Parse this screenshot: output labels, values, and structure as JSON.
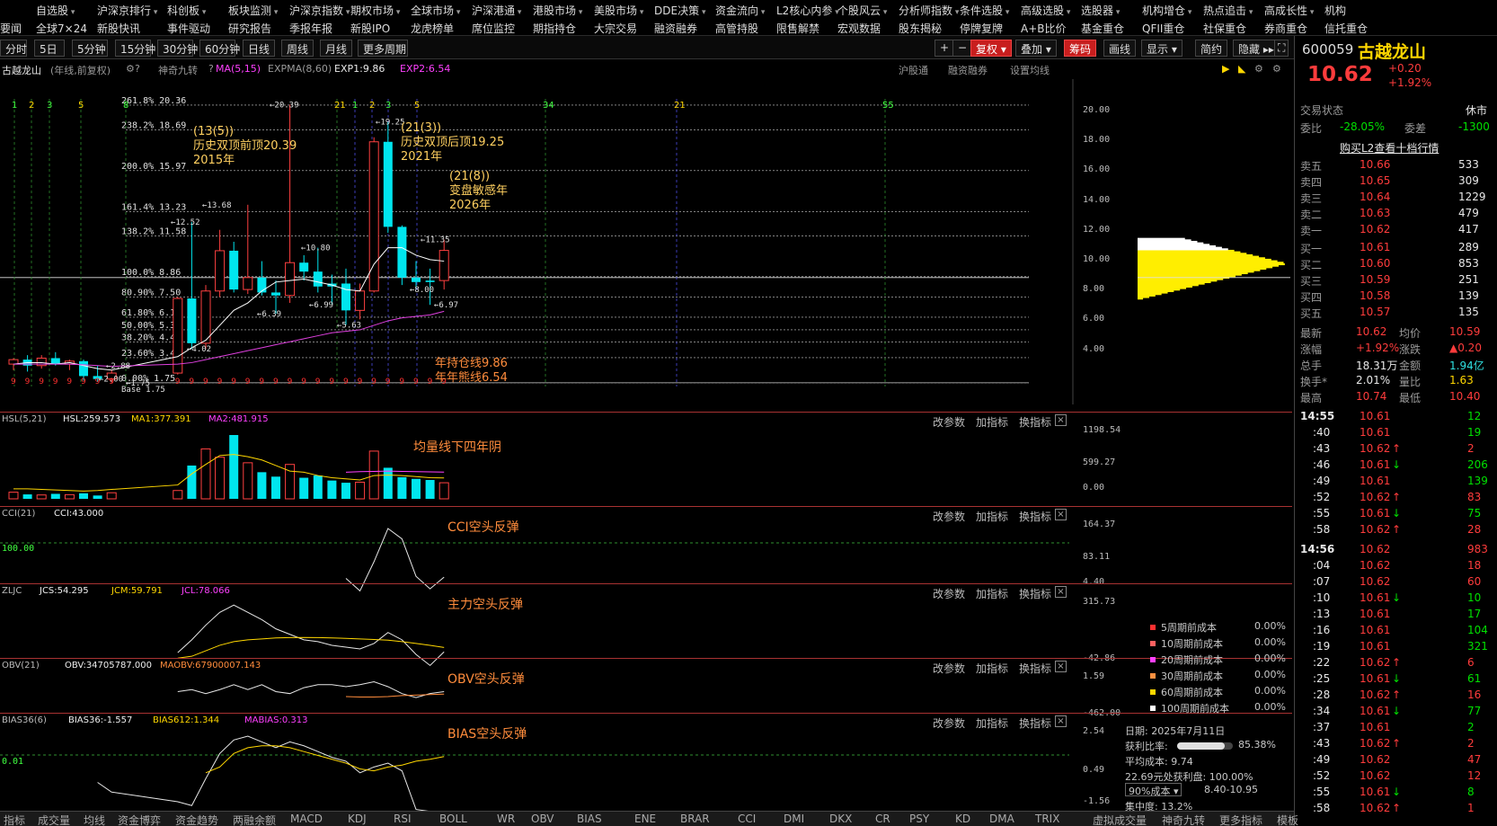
{
  "menu": {
    "row1": [
      "自选股",
      "沪深京排行",
      "科创板",
      "板块监测",
      "沪深京指数",
      "期权市场",
      "全球市场",
      "沪深港通",
      "港股市场",
      "美股市场",
      "DDE决策",
      "资金流向",
      "L2核心内参",
      "个股风云",
      "分析师指数",
      "条件选股",
      "高级选股",
      "选股器",
      "机构增仓",
      "热点追击",
      "高成长性",
      "机构"
    ],
    "row2": [
      "要闻",
      "全球7×24",
      "新股快讯",
      "事件驱动",
      "研究报告",
      "季报年报",
      "新股IPO",
      "龙虎榜单",
      "席位监控",
      "期指持仓",
      "大宗交易",
      "融资融券",
      "高管持股",
      "限售解禁",
      "宏观数据",
      "股东揭秘",
      "停牌复牌",
      "A+B比价",
      "基金重仓",
      "QFII重仓",
      "社保重仓",
      "券商重仓",
      "信托重仓"
    ]
  },
  "toolbar": {
    "periods": [
      "分时",
      "5日",
      "5分钟",
      "15分钟",
      "30分钟",
      "60分钟",
      "日线",
      "周线",
      "月线",
      "更多周期"
    ],
    "plus": "+",
    "minus": "−",
    "fuquan": "复权",
    "diejia": "叠加",
    "chouma": "筹码",
    "huaxian": "画线",
    "xianshi": "显示",
    "jianyue": "简约",
    "yincang": "隐藏"
  },
  "chart": {
    "stock_name": "古越龙山",
    "mode": "(年线,前复权)",
    "indicator": "神奇九转",
    "ma_label": "MA(5,15)",
    "expma_label": "EXPMA(8,60)",
    "exp1": "EXP1:9.86",
    "exp2": "EXP2:6.54",
    "links": [
      "沪股通",
      "融资融券",
      "设置均线"
    ],
    "fib_levels": [
      {
        "label": "261.8% 20.36",
        "value": 20.36
      },
      {
        "label": "238.2% 18.69",
        "value": 18.69
      },
      {
        "label": "200.0% 15.97",
        "value": 15.97
      },
      {
        "label": "161.4% 13.23",
        "value": 13.23
      },
      {
        "label": "138.2% 11.58",
        "value": 11.58
      },
      {
        "label": "100.0% 8.86",
        "value": 8.86
      },
      {
        "label": "80.90% 7.50",
        "value": 7.5
      },
      {
        "label": "61.80% 6.14",
        "value": 6.14
      },
      {
        "label": "50.00% 5.30",
        "value": 5.3
      },
      {
        "label": "38.20% 4.47",
        "value": 4.47
      },
      {
        "label": "23.60% 3.43",
        "value": 3.43
      },
      {
        "label": "0.00% 1.75",
        "value": 1.75
      },
      {
        "label": "Base 1.75",
        "value": 1.75
      }
    ],
    "y_ticks": [
      "20.00",
      "18.00",
      "16.00",
      "14.00",
      "12.00",
      "10.00",
      "8.00",
      "6.00",
      "4.00"
    ],
    "cycle_marks": [
      "1",
      "2",
      "3",
      "5",
      "8",
      "21",
      "1",
      "2",
      "3",
      "5",
      "34",
      "21",
      "55"
    ],
    "annotations": [
      {
        "line1": "(13(5))",
        "line2": "历史双顶前顶20.39",
        "line3": "2015年"
      },
      {
        "line1": "(21(3))",
        "line2": "历史双顶后顶19.25",
        "line3": "2021年"
      },
      {
        "line1": "(21(8))",
        "line2": "变盘敏感年",
        "line3": "2026年"
      }
    ],
    "price_labels": [
      "20.39",
      "19.25",
      "13.68",
      "12.52",
      "10.80",
      "11.35",
      "8.00",
      "6.97",
      "6.99",
      "6.39",
      "5.63",
      "4.02",
      "2.88",
      "2.00",
      "1.75"
    ],
    "year_lines": "年持仓线9.86",
    "year_lines2": "年年熊线6.54",
    "nine_marks": "9"
  },
  "panels": {
    "hsl": {
      "title": "HSL(5,21)",
      "v": "HSL:259.573",
      "ma1": "MA1:377.391",
      "ma2": "MA2:481.915",
      "note": "均量线下四年阴",
      "y": [
        "1198.54",
        "599.27",
        "0.00"
      ]
    },
    "cci": {
      "title": "CCI(21)",
      "v": "CCI:43.000",
      "note": "CCI空头反弹",
      "y": [
        "164.37",
        "83.11",
        "4.40"
      ],
      "left": "100.00"
    },
    "zljc": {
      "title": "ZLJC",
      "jcs": "JCS:54.295",
      "jcm": "JCM:59.791",
      "jcl": "JCL:78.066",
      "note": "主力空头反弹",
      "y": [
        "315.73",
        "-42.86"
      ]
    },
    "obv": {
      "title": "OBV(21)",
      "v": "OBV:34705787.000",
      "maobv": "MAOBV:67900007.143",
      "note": "OBV空头反弹",
      "y": [
        "1.59",
        "-462.00"
      ]
    },
    "bias": {
      "title": "BIAS36(6)",
      "v": "BIAS36:-1.557",
      "b612": "BIAS612:1.344",
      "mabias": "MABIAS:0.313",
      "note": "BIAS空头反弹",
      "y": [
        "2.54",
        "0.49",
        "-1.56"
      ],
      "left": "0.01"
    },
    "buttons": [
      "改参数",
      "加指标",
      "换指标"
    ]
  },
  "chip": {
    "legend": [
      {
        "label": "5周期前成本",
        "value": "0.00%",
        "color": "#ff3030"
      },
      {
        "label": "10周期前成本",
        "value": "0.00%",
        "color": "#ff6060"
      },
      {
        "label": "20周期前成本",
        "value": "0.00%",
        "color": "#ff40ff"
      },
      {
        "label": "30周期前成本",
        "value": "0.00%",
        "color": "#ff9040"
      },
      {
        "label": "60周期前成本",
        "value": "0.00%",
        "color": "#ffd700"
      },
      {
        "label": "100周期前成本",
        "value": "0.00%",
        "color": "#ffffff"
      }
    ],
    "date": "日期: 2025年7月11日",
    "profit_label": "获利比率:",
    "profit": "85.38%",
    "profit_fraction": 0.8538,
    "avg_cost": "平均成本: 9.74",
    "profit_line": "22.69元处获利盘: 100.00%",
    "cost_select": "90%成本",
    "cost_range": "8.40-10.95",
    "concentration": "集中度: 13.2%"
  },
  "quote": {
    "code": "600059",
    "name": "古越龙山",
    "price": "10.62",
    "change": "+0.20",
    "change_pct": "+1.92%",
    "status_label": "交易状态",
    "status": "休市",
    "weibi_label": "委比",
    "weibi": "-28.05%",
    "weicha_label": "委差",
    "weicha": "-1300",
    "l2_link": "购买L2查看十档行情",
    "sells": [
      {
        "label": "卖五",
        "price": "10.66",
        "vol": "533"
      },
      {
        "label": "卖四",
        "price": "10.65",
        "vol": "309"
      },
      {
        "label": "卖三",
        "price": "10.64",
        "vol": "1229"
      },
      {
        "label": "卖二",
        "price": "10.63",
        "vol": "479"
      },
      {
        "label": "卖一",
        "price": "10.62",
        "vol": "417"
      }
    ],
    "buys": [
      {
        "label": "买一",
        "price": "10.61",
        "vol": "289"
      },
      {
        "label": "买二",
        "price": "10.60",
        "vol": "853"
      },
      {
        "label": "买三",
        "price": "10.59",
        "vol": "251"
      },
      {
        "label": "买四",
        "price": "10.58",
        "vol": "139"
      },
      {
        "label": "买五",
        "price": "10.57",
        "vol": "135"
      }
    ],
    "stats": [
      {
        "l1": "最新",
        "v1": "10.62",
        "c1": "red",
        "l2": "均价",
        "v2": "10.59",
        "c2": "red"
      },
      {
        "l1": "涨幅",
        "v1": "+1.92%",
        "c1": "red",
        "l2": "涨跌",
        "v2": "▲0.20",
        "c2": "red"
      },
      {
        "l1": "总手",
        "v1": "18.31万",
        "c1": "white",
        "l2": "金额",
        "v2": "1.94亿",
        "c2": "cyan"
      },
      {
        "l1": "换手*",
        "v1": "2.01%",
        "c1": "white",
        "l2": "量比",
        "v2": "1.63",
        "c2": "yellow"
      },
      {
        "l1": "最高",
        "v1": "10.74",
        "c1": "red",
        "l2": "最低",
        "v2": "10.40",
        "c2": "red"
      }
    ],
    "ticks1": {
      "time": "14:55",
      "rows": [
        {
          "t": "14:55",
          "p": "10.61",
          "pc": "red",
          "a": "",
          "v": "12",
          "vc": "green"
        },
        {
          "t": ":40",
          "p": "10.61",
          "pc": "red",
          "a": "",
          "v": "19",
          "vc": "green"
        },
        {
          "t": ":43",
          "p": "10.62",
          "pc": "red",
          "a": "↑",
          "v": "2",
          "vc": "red"
        },
        {
          "t": ":46",
          "p": "10.61",
          "pc": "red",
          "a": "↓",
          "v": "206",
          "vc": "green"
        },
        {
          "t": ":49",
          "p": "10.61",
          "pc": "red",
          "a": "",
          "v": "139",
          "vc": "green"
        },
        {
          "t": ":52",
          "p": "10.62",
          "pc": "red",
          "a": "↑",
          "v": "83",
          "vc": "red"
        },
        {
          "t": ":55",
          "p": "10.61",
          "pc": "red",
          "a": "↓",
          "v": "75",
          "vc": "green"
        },
        {
          "t": ":58",
          "p": "10.62",
          "pc": "red",
          "a": "↑",
          "v": "28",
          "vc": "red"
        }
      ]
    },
    "ticks2": {
      "rows": [
        {
          "t": "14:56",
          "p": "10.62",
          "pc": "red",
          "a": "",
          "v": "983",
          "vc": "red"
        },
        {
          "t": ":04",
          "p": "10.62",
          "pc": "red",
          "a": "",
          "v": "18",
          "vc": "red"
        },
        {
          "t": ":07",
          "p": "10.62",
          "pc": "red",
          "a": "",
          "v": "60",
          "vc": "red"
        },
        {
          "t": ":10",
          "p": "10.61",
          "pc": "red",
          "a": "↓",
          "v": "10",
          "vc": "green"
        },
        {
          "t": ":13",
          "p": "10.61",
          "pc": "red",
          "a": "",
          "v": "17",
          "vc": "green"
        },
        {
          "t": ":16",
          "p": "10.61",
          "pc": "red",
          "a": "",
          "v": "104",
          "vc": "green"
        },
        {
          "t": ":19",
          "p": "10.61",
          "pc": "red",
          "a": "",
          "v": "321",
          "vc": "green"
        },
        {
          "t": ":22",
          "p": "10.62",
          "pc": "red",
          "a": "↑",
          "v": "6",
          "vc": "red"
        },
        {
          "t": ":25",
          "p": "10.61",
          "pc": "red",
          "a": "↓",
          "v": "61",
          "vc": "green"
        },
        {
          "t": ":28",
          "p": "10.62",
          "pc": "red",
          "a": "↑",
          "v": "16",
          "vc": "red"
        },
        {
          "t": ":34",
          "p": "10.61",
          "pc": "red",
          "a": "↓",
          "v": "77",
          "vc": "green"
        },
        {
          "t": ":37",
          "p": "10.61",
          "pc": "red",
          "a": "",
          "v": "2",
          "vc": "green"
        },
        {
          "t": ":43",
          "p": "10.62",
          "pc": "red",
          "a": "↑",
          "v": "2",
          "vc": "red"
        },
        {
          "t": ":49",
          "p": "10.62",
          "pc": "red",
          "a": "",
          "v": "47",
          "vc": "red"
        },
        {
          "t": ":52",
          "p": "10.62",
          "pc": "red",
          "a": "",
          "v": "12",
          "vc": "red"
        },
        {
          "t": ":55",
          "p": "10.61",
          "pc": "red",
          "a": "↓",
          "v": "8",
          "vc": "green"
        },
        {
          "t": ":58",
          "p": "10.62",
          "pc": "red",
          "a": "↑",
          "v": "1",
          "vc": "red"
        }
      ]
    }
  },
  "tabs": [
    "指标",
    "成交量",
    "均线",
    "资金博弈",
    "资金趋势",
    "两融余额",
    "MACD",
    "KDJ",
    "RSI",
    "BOLL",
    "WR",
    "OBV",
    "BIAS",
    "ENE",
    "BRAR",
    "CCI",
    "DMI",
    "DKX",
    "CR",
    "PSY",
    "KD",
    "DMA",
    "TRIX",
    "虚拟成交量",
    "神奇九转",
    "更多指标",
    "模板"
  ],
  "chart_data": {
    "type": "candlestick",
    "candles": [
      {
        "o": 3.0,
        "h": 3.4,
        "l": 2.6,
        "c": 3.3,
        "up": true
      },
      {
        "o": 3.3,
        "h": 3.6,
        "l": 2.5,
        "c": 2.9,
        "up": false
      },
      {
        "o": 2.9,
        "h": 3.6,
        "l": 2.7,
        "c": 3.4,
        "up": true
      },
      {
        "o": 3.4,
        "h": 3.8,
        "l": 2.9,
        "c": 3.0,
        "up": false
      },
      {
        "o": 3.0,
        "h": 3.3,
        "l": 2.6,
        "c": 3.2,
        "up": true
      },
      {
        "o": 3.2,
        "h": 3.3,
        "l": 1.9,
        "c": 2.2,
        "up": false
      },
      {
        "o": 2.2,
        "h": 2.9,
        "l": 1.8,
        "c": 2.0,
        "up": false
      },
      {
        "o": 2.0,
        "h": 2.6,
        "l": 1.75,
        "c": 2.4,
        "up": true
      },
      {
        "o": 2.4,
        "h": 7.5,
        "l": 2.3,
        "c": 7.4,
        "up": true
      },
      {
        "o": 7.4,
        "h": 12.52,
        "l": 4.02,
        "c": 4.4,
        "up": false
      },
      {
        "o": 4.4,
        "h": 8.3,
        "l": 4.0,
        "c": 7.9,
        "up": true
      },
      {
        "o": 7.9,
        "h": 12.0,
        "l": 7.5,
        "c": 10.6,
        "up": true
      },
      {
        "o": 10.6,
        "h": 11.2,
        "l": 7.8,
        "c": 8.0,
        "up": false
      },
      {
        "o": 8.0,
        "h": 13.68,
        "l": 7.7,
        "c": 8.8,
        "up": true
      },
      {
        "o": 8.8,
        "h": 9.9,
        "l": 7.6,
        "c": 7.8,
        "up": false
      },
      {
        "o": 7.8,
        "h": 8.6,
        "l": 6.39,
        "c": 7.6,
        "up": false
      },
      {
        "o": 7.6,
        "h": 20.39,
        "l": 7.1,
        "c": 9.8,
        "up": true
      },
      {
        "o": 9.8,
        "h": 10.3,
        "l": 8.6,
        "c": 9.2,
        "up": false
      },
      {
        "o": 9.2,
        "h": 10.8,
        "l": 7.8,
        "c": 8.2,
        "up": false
      },
      {
        "o": 8.2,
        "h": 9.0,
        "l": 6.99,
        "c": 8.4,
        "up": false
      },
      {
        "o": 8.4,
        "h": 9.4,
        "l": 5.63,
        "c": 6.6,
        "up": false
      },
      {
        "o": 6.6,
        "h": 8.4,
        "l": 6.0,
        "c": 7.9,
        "up": true
      },
      {
        "o": 7.9,
        "h": 18.2,
        "l": 7.8,
        "c": 17.9,
        "up": true
      },
      {
        "o": 17.9,
        "h": 19.25,
        "l": 11.8,
        "c": 12.2,
        "up": false
      },
      {
        "o": 12.2,
        "h": 12.3,
        "l": 8.3,
        "c": 8.8,
        "up": false
      },
      {
        "o": 8.8,
        "h": 9.9,
        "l": 8.0,
        "c": 8.5,
        "up": false
      },
      {
        "o": 8.5,
        "h": 9.4,
        "l": 6.97,
        "c": 8.6,
        "up": false
      },
      {
        "o": 8.6,
        "h": 11.35,
        "l": 8.0,
        "c": 10.62,
        "up": true
      }
    ],
    "ma": [
      3.0,
      3.1,
      3.1,
      3.0,
      3.1,
      2.9,
      2.7,
      2.6,
      3.5,
      4.1,
      4.6,
      5.6,
      6.6,
      7.1,
      7.9,
      8.5,
      8.6,
      8.7,
      8.5,
      8.3,
      8.0,
      7.9,
      9.7,
      10.8,
      10.8,
      10.3,
      10.0,
      9.9
    ],
    "expma": [
      3.0,
      3.0,
      3.0,
      3.0,
      3.0,
      2.95,
      2.9,
      2.85,
      3.0,
      3.1,
      3.3,
      3.5,
      3.7,
      3.9,
      4.1,
      4.3,
      4.5,
      4.7,
      4.9,
      5.1,
      5.2,
      5.3,
      5.6,
      5.9,
      6.1,
      6.2,
      6.3,
      6.54
    ],
    "ylim": [
      1.5,
      21.5
    ],
    "hsl": {
      "values": [
        120,
        80,
        70,
        90,
        75,
        100,
        60,
        110,
        150,
        600,
        900,
        750,
        1150,
        650,
        480,
        400,
        620,
        380,
        420,
        330,
        290,
        300,
        860,
        560,
        390,
        360,
        340,
        290
      ],
      "ma1": [
        180,
        180,
        170,
        160,
        150,
        140,
        150,
        170,
        250,
        450,
        620,
        780,
        800,
        760,
        700,
        600,
        500,
        480,
        420,
        380,
        360,
        340,
        420,
        430,
        420,
        400,
        380,
        377
      ],
      "ma2": [
        null,
        null,
        null,
        null,
        null,
        null,
        null,
        null,
        null,
        null,
        null,
        null,
        null,
        null,
        null,
        null,
        null,
        null,
        null,
        null,
        480,
        490,
        495,
        500,
        495,
        490,
        485,
        482
      ],
      "ymax": 1198.54
    },
    "cci": {
      "values": [
        null,
        null,
        null,
        null,
        null,
        null,
        null,
        null,
        null,
        null,
        null,
        null,
        null,
        null,
        null,
        null,
        null,
        null,
        null,
        null,
        40,
        10,
        80,
        160,
        135,
        45,
        15,
        43
      ],
      "ymin": 4.4,
      "ymax": 164.37
    },
    "zljc": {
      "jcs": [
        null,
        null,
        null,
        null,
        null,
        null,
        null,
        null,
        50,
        120,
        200,
        270,
        310,
        270,
        230,
        180,
        150,
        120,
        110,
        90,
        80,
        70,
        100,
        160,
        120,
        40,
        -20,
        54
      ],
      "jcl": [
        null,
        null,
        null,
        null,
        null,
        null,
        null,
        null,
        20,
        30,
        60,
        90,
        110,
        120,
        125,
        130,
        132,
        133,
        132,
        130,
        128,
        125,
        122,
        118,
        110,
        100,
        90,
        78
      ],
      "ymin": -42.86,
      "ymax": 315.73
    },
    "obv": {
      "values": [
        null,
        null,
        null,
        null,
        null,
        null,
        null,
        null,
        -130,
        -110,
        -150,
        -110,
        -60,
        -110,
        -60,
        -130,
        -150,
        -90,
        -60,
        -60,
        -80,
        -60,
        -30,
        -80,
        -150,
        -190,
        -150,
        -130
      ],
      "ma": [
        null,
        null,
        null,
        null,
        null,
        null,
        null,
        null,
        null,
        null,
        null,
        null,
        null,
        null,
        null,
        null,
        null,
        null,
        null,
        null,
        -180,
        -185,
        -185,
        -180,
        -170,
        -165,
        -160,
        -155
      ],
      "ymin": -462,
      "ymax": 1.59
    },
    "bias": {
      "values": [
        null,
        null,
        null,
        null,
        null,
        null,
        0.0,
        -0.5,
        -1.0,
        -1.2,
        0.2,
        1.5,
        2.2,
        2.4,
        2.1,
        1.8,
        2.1,
        1.9,
        1.6,
        1.3,
        1.1,
        0.5,
        0.8,
        1.0,
        0.6,
        -1.4,
        -1.5,
        -1.56
      ],
      "b612": [
        null,
        null,
        null,
        null,
        null,
        null,
        null,
        null,
        null,
        null,
        0.5,
        0.8,
        1.5,
        1.8,
        1.9,
        1.9,
        1.8,
        1.6,
        1.4,
        1.2,
        1.0,
        0.7,
        0.6,
        0.8,
        0.9,
        1.1,
        1.2,
        1.34
      ],
      "ymin": -1.56,
      "ymax": 2.54
    }
  }
}
